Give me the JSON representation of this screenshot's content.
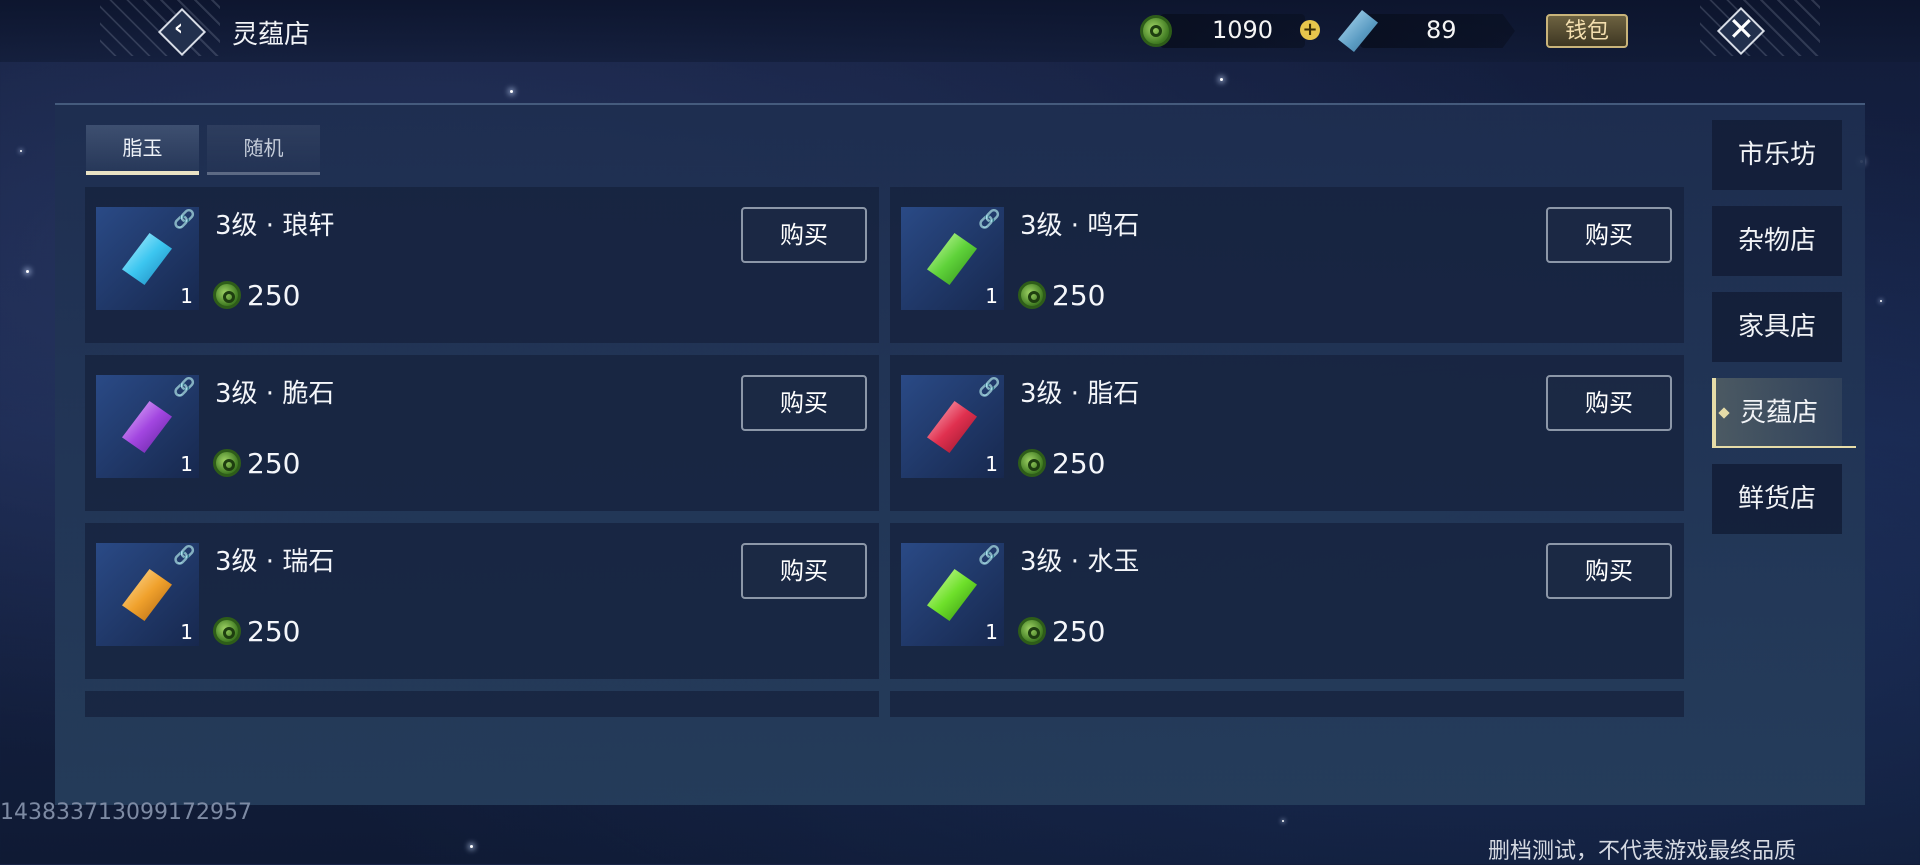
{
  "header": {
    "title": "灵蕴店",
    "currency_coin": "1090",
    "currency_jade": "89",
    "wallet_label": "钱包"
  },
  "tabs": [
    {
      "label": "脂玉",
      "active": true
    },
    {
      "label": "随机",
      "active": false
    }
  ],
  "items": [
    {
      "name": "3级 · 琅轩",
      "qty": "1",
      "price": "250",
      "buy_label": "购买",
      "gem_color": "#3cc6f0"
    },
    {
      "name": "3级 · 鸣石",
      "qty": "1",
      "price": "250",
      "buy_label": "购买",
      "gem_color": "#5fd23a"
    },
    {
      "name": "3级 · 脆石",
      "qty": "1",
      "price": "250",
      "buy_label": "购买",
      "gem_color": "#a246e0"
    },
    {
      "name": "3级 · 脂石",
      "qty": "1",
      "price": "250",
      "buy_label": "购买",
      "gem_color": "#e0304f"
    },
    {
      "name": "3级 · 瑞石",
      "qty": "1",
      "price": "250",
      "buy_label": "购买",
      "gem_color": "#f0a12c"
    },
    {
      "name": "3级 · 水玉",
      "qty": "1",
      "price": "250",
      "buy_label": "购买",
      "gem_color": "#6ee02a"
    }
  ],
  "side_nav": [
    {
      "label": "市乐坊",
      "active": false
    },
    {
      "label": "杂物店",
      "active": false
    },
    {
      "label": "家具店",
      "active": false
    },
    {
      "label": "灵蕴店",
      "active": true
    },
    {
      "label": "鲜货店",
      "active": false
    }
  ],
  "footer": {
    "uid": "143833713099172957",
    "notice": "删档测试，不代表游戏最终品质"
  },
  "icons": {
    "back": "back-arrow-icon",
    "close": "close-icon",
    "coin": "coin-icon",
    "jade": "jade-icon",
    "plus": "plus-icon",
    "link": "link-icon"
  }
}
